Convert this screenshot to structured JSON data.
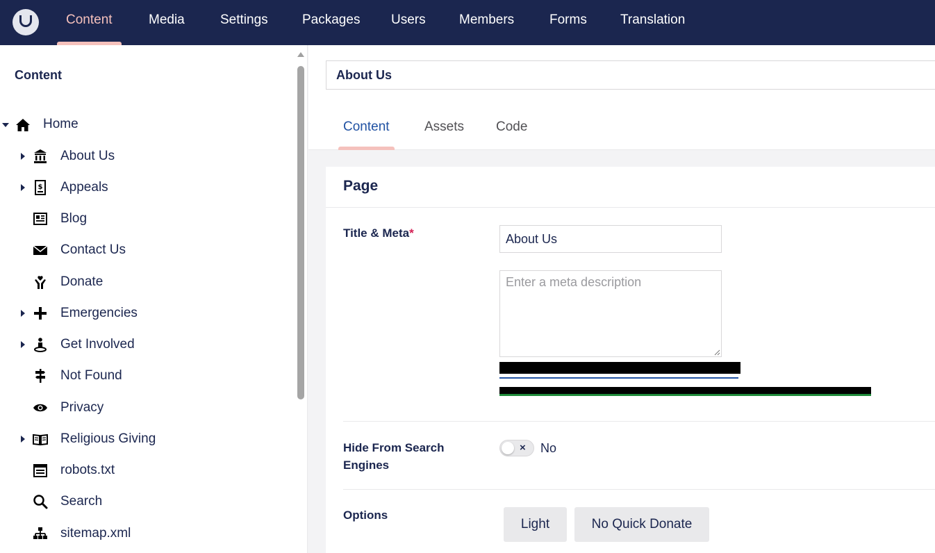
{
  "nav": {
    "items": [
      "Content",
      "Media",
      "Settings",
      "Packages",
      "Users",
      "Members",
      "Forms",
      "Translation"
    ],
    "active": "Content",
    "colors": {
      "bar": "#1b264f",
      "active": "#f5c1bc"
    }
  },
  "sidebar": {
    "title": "Content",
    "tree": [
      {
        "label": "Home",
        "icon": "home-icon",
        "caret": "down"
      },
      {
        "label": "About Us",
        "icon": "bank-icon",
        "caret": "right"
      },
      {
        "label": "Appeals",
        "icon": "donation-receipt-icon",
        "caret": "right"
      },
      {
        "label": "Blog",
        "icon": "newspaper-icon",
        "caret": "none"
      },
      {
        "label": "Contact Us",
        "icon": "envelope-icon",
        "caret": "none"
      },
      {
        "label": "Donate",
        "icon": "helping-hands-icon",
        "caret": "none"
      },
      {
        "label": "Emergencies",
        "icon": "plus-icon",
        "caret": "right"
      },
      {
        "label": "Get Involved",
        "icon": "volunteer-icon",
        "caret": "right"
      },
      {
        "label": "Not Found",
        "icon": "signpost-icon",
        "caret": "none"
      },
      {
        "label": "Privacy",
        "icon": "eye-icon",
        "caret": "none"
      },
      {
        "label": "Religious Giving",
        "icon": "open-book-icon",
        "caret": "right"
      },
      {
        "label": "robots.txt",
        "icon": "document-icon",
        "caret": "none"
      },
      {
        "label": "Search",
        "icon": "search-icon",
        "caret": "none"
      },
      {
        "label": "sitemap.xml",
        "icon": "sitemap-icon",
        "caret": "none"
      }
    ]
  },
  "editor": {
    "node_name": "About Us",
    "tabs": [
      "Content",
      "Assets",
      "Code"
    ],
    "active_tab": "Content",
    "group_title": "Page",
    "title_meta": {
      "label": "Title & Meta",
      "required_mark": "*",
      "title_value": "About Us",
      "description_placeholder": "Enter a meta description"
    },
    "hide_from_search": {
      "label": "Hide From Search Engines",
      "value_text": "No",
      "toggle_mark": "×"
    },
    "options": {
      "label": "Options",
      "buttons": [
        "Light",
        "No Quick Donate"
      ]
    }
  }
}
